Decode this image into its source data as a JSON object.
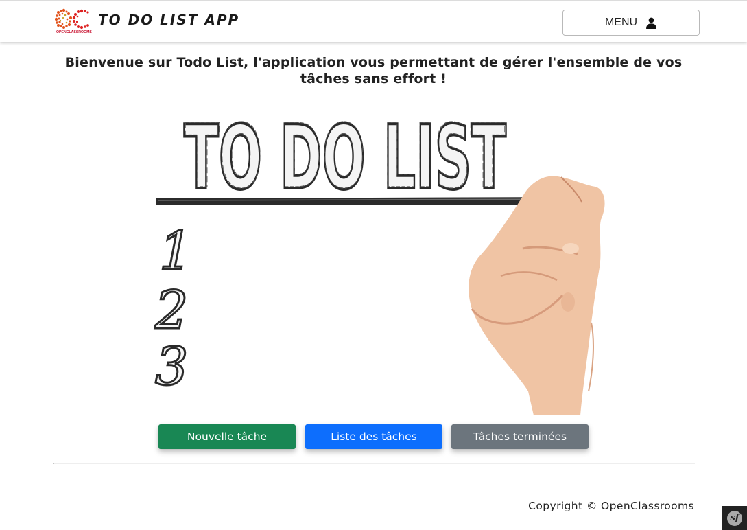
{
  "header": {
    "logo_text": "OPENCLASSROOMS",
    "title": "TO DO LIST APP",
    "menu_label": "MENU",
    "menu_icon": "user-icon"
  },
  "main": {
    "welcome": "Bienvenue sur Todo List, l'application vous permettant de gérer l'ensemble de vos tâches sans effort !",
    "hero": {
      "heading": "TO DO LIST",
      "numbers": [
        "1",
        "2",
        "3"
      ]
    },
    "buttons": {
      "new_task": "Nouvelle tâche",
      "task_list": "Liste des tâches",
      "done_tasks": "Tâches terminées"
    }
  },
  "footer": {
    "copyright": "Copyright © OpenClassrooms"
  },
  "debug_toolbar": {
    "icon": "symfony-icon",
    "glyph": "sf"
  },
  "colors": {
    "success": "#198754",
    "primary": "#0d6efd",
    "secondary": "#6c757d"
  }
}
